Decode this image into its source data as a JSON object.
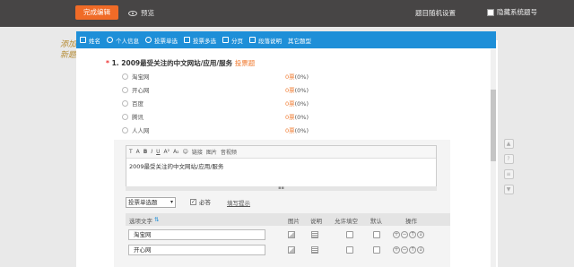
{
  "topbar": {
    "done_label": "完成编辑",
    "preview_label": "预览",
    "random_label": "题目随机设置",
    "hide_num_label": "隐藏系统题号"
  },
  "watermark": "添加新题",
  "toolbar": {
    "items": [
      {
        "label": "姓名",
        "icon": "person-icon"
      },
      {
        "label": "个人信息",
        "icon": "user-circle-icon"
      },
      {
        "label": "投票单选",
        "icon": "radio-icon"
      },
      {
        "label": "投票多选",
        "icon": "checkbox-icon"
      },
      {
        "label": "分页",
        "icon": "page-break-icon"
      },
      {
        "label": "段落说明",
        "icon": "paragraph-icon"
      },
      {
        "label": "其它题型",
        "icon": ""
      }
    ]
  },
  "question": {
    "required_mark": "*",
    "number": "1.",
    "title": "2009最受关注的中文网站/应用/服务",
    "tag": "投票题"
  },
  "options": [
    {
      "label": "淘宝网",
      "count": "0票",
      "percent": "(0%)"
    },
    {
      "label": "开心网",
      "count": "0票",
      "percent": "(0%)"
    },
    {
      "label": "百度",
      "count": "0票",
      "percent": "(0%)"
    },
    {
      "label": "腾讯",
      "count": "0票",
      "percent": "(0%)"
    },
    {
      "label": "人人网",
      "count": "0票",
      "percent": "(0%)"
    }
  ],
  "editor": {
    "tools": [
      "T",
      "A",
      "B",
      "I",
      "U",
      "A²",
      "A₂",
      "☺",
      "链接",
      "图片",
      "音视频"
    ],
    "content": "2009最受关注的中文网站/应用/服务",
    "type_select": "投票单选题",
    "required_label": "必答",
    "tip_link": "填写提示"
  },
  "table": {
    "headers": {
      "text": "选项文字",
      "sort": "⇅",
      "image": "图片",
      "desc": "说明",
      "allow_fill": "允许填空",
      "default": "默认",
      "ops": "操作"
    },
    "rows": [
      {
        "value": "淘宝网"
      },
      {
        "value": "开心网"
      }
    ]
  },
  "side_tools": [
    "▲",
    "?",
    "≡",
    "▼"
  ]
}
